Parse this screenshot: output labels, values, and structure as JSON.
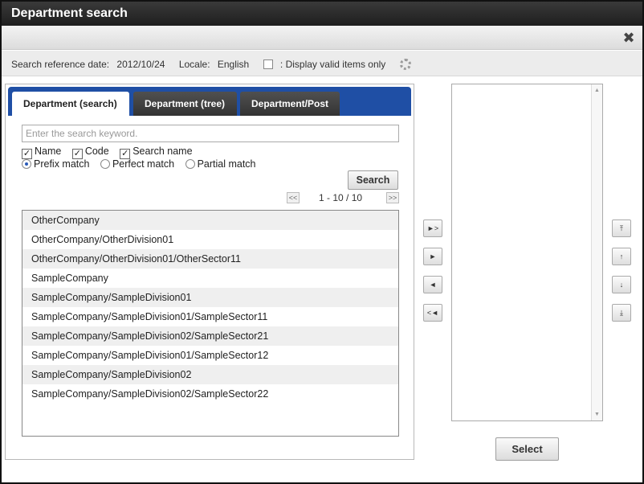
{
  "window": {
    "title": "Department search"
  },
  "toolbar": {
    "close_icon": "close-icon"
  },
  "info": {
    "ref_date_label": "Search reference date:",
    "ref_date_value": "2012/10/24",
    "locale_label": "Locale:",
    "locale_value": "English",
    "valid_only_label": ": Display valid items only"
  },
  "tabs": [
    {
      "label": "Department (search)"
    },
    {
      "label": "Department (tree)"
    },
    {
      "label": "Department/Post"
    }
  ],
  "search": {
    "placeholder": "Enter the search keyword.",
    "checks": {
      "name": "Name",
      "code": "Code",
      "search_name": "Search name"
    },
    "match": {
      "prefix": "Prefix match",
      "perfect": "Perfect match",
      "partial": "Partial match"
    },
    "button": "Search"
  },
  "pager": {
    "text": "1 - 10 / 10"
  },
  "results": [
    "OtherCompany",
    "OtherCompany/OtherDivision01",
    "OtherCompany/OtherDivision01/OtherSector11",
    "SampleCompany",
    "SampleCompany/SampleDivision01",
    "SampleCompany/SampleDivision01/SampleSector11",
    "SampleCompany/SampleDivision02/SampleSector21",
    "SampleCompany/SampleDivision01/SampleSector12",
    "SampleCompany/SampleDivision02",
    "SampleCompany/SampleDivision02/SampleSector22"
  ],
  "select_button": "Select"
}
